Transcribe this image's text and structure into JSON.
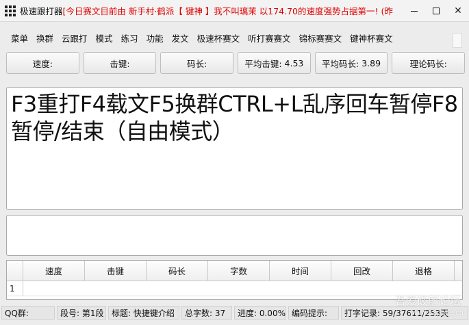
{
  "window": {
    "app_title": "极速跟打器",
    "title_marquee": "[今日赛文目前由 新手村·鹤派【 键神 】我不叫璃茉 以174.70的速度强势占据第一! (昨",
    "controls": {
      "minimize": "—",
      "maximize": "",
      "close": "✕"
    },
    "icon": "grid-app-icon"
  },
  "menu": {
    "items": [
      "菜单",
      "换群",
      "云跟打",
      "模式",
      "练习",
      "功能",
      "发文",
      "极速杯赛文",
      "听打赛赛文",
      "锦标赛赛文",
      "键神杯赛文"
    ]
  },
  "stats": {
    "speed_label": "速度:",
    "keystroke_label": "击键:",
    "code_length_label": "码长:",
    "avg_keystroke_label": "平均击键:",
    "avg_keystroke_value": "4.53",
    "avg_code_length_label": "平均码长:",
    "avg_code_length_value": "3.89",
    "theory_code_length_label": "理论码长:"
  },
  "article": {
    "text": "F3重打F4载文F5换群CTRL+L乱序回车暂停F8暂停/结束（自由模式）"
  },
  "input": {
    "value": ""
  },
  "table": {
    "columns": [
      "速度",
      "击键",
      "码长",
      "字数",
      "时间",
      "回改",
      "退格"
    ],
    "rows": [
      {
        "index": "1"
      }
    ]
  },
  "status": {
    "qq_group": "QQ群:",
    "paragraph": "段号: 第1段",
    "title": "标题: 快捷键介绍",
    "total_chars": "总字数: 37",
    "progress": "进度: 0.00%",
    "code_hint": "编码提示:",
    "record": "打字记录: 59/37611/253天"
  },
  "watermark": {
    "text": "吾爱破解论坛",
    "sub": "www.52pojie.cn"
  }
}
